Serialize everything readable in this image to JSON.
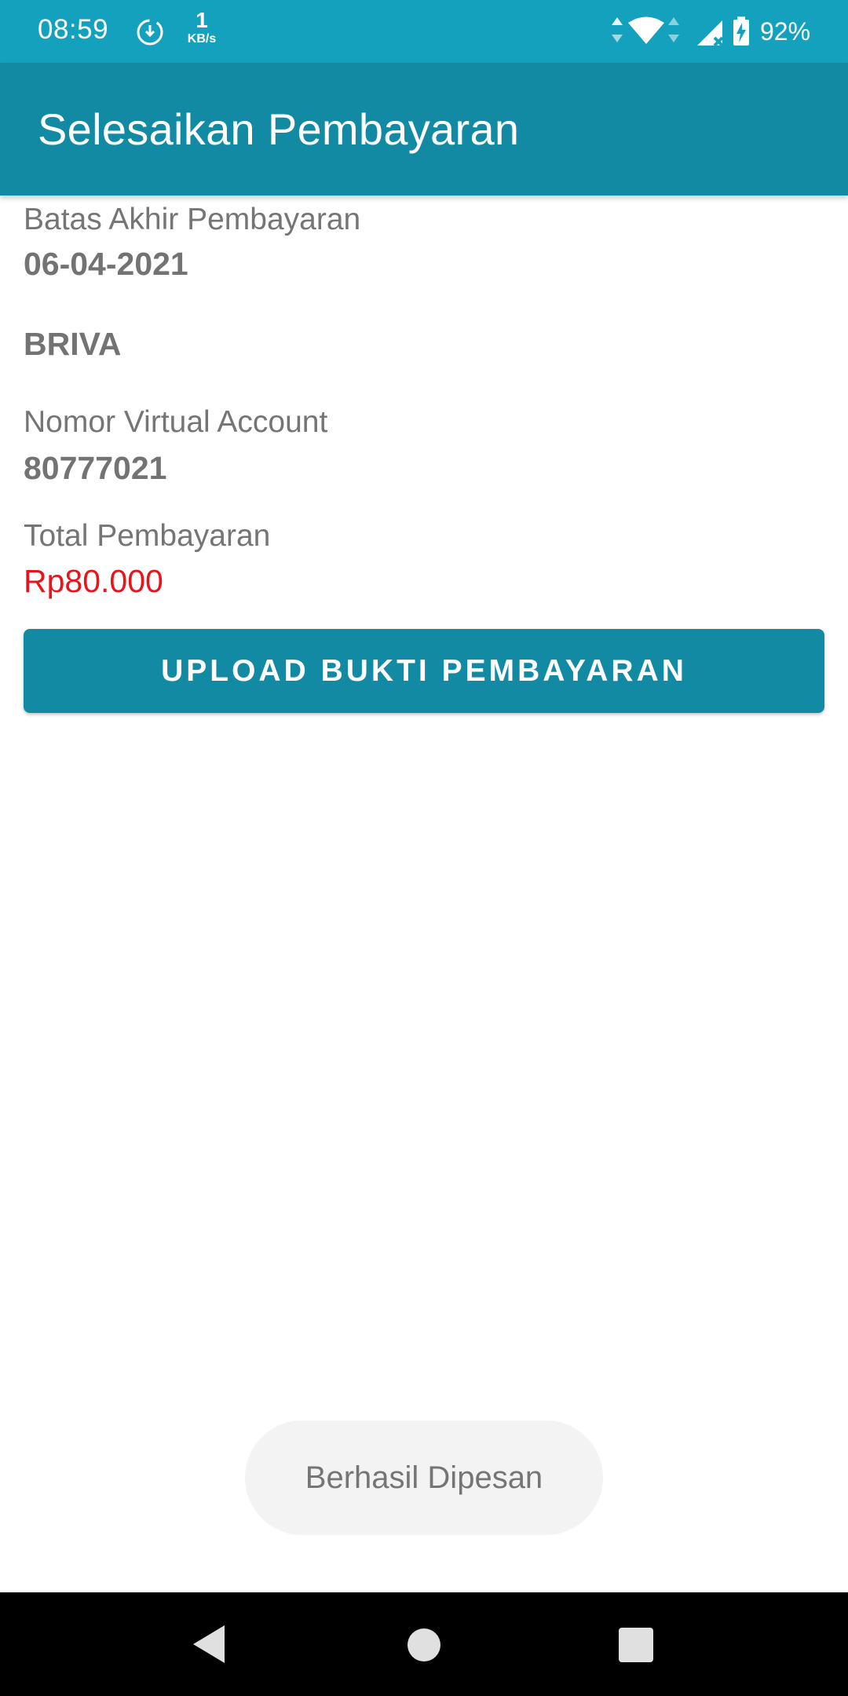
{
  "status_bar": {
    "time": "08:59",
    "speed_value": "1",
    "speed_unit": "KB/s",
    "battery": "92%",
    "icons": [
      "sync-icon",
      "data-arrows-icon",
      "wifi-icon",
      "signal-icon",
      "battery-icon"
    ]
  },
  "app_bar": {
    "title": "Selesaikan Pembayaran"
  },
  "payment": {
    "deadline_label": "Batas Akhir Pembayaran",
    "deadline_value": "06-04-2021",
    "bank": "BRIVA",
    "va_label": "Nomor Virtual Account",
    "va_value": "80777021",
    "total_label": "Total Pembayaran",
    "total_value": "Rp80.000"
  },
  "actions": {
    "upload_label": "UPLOAD BUKTI PEMBAYARAN"
  },
  "toast": {
    "message": "Berhasil Dipesan"
  },
  "nav_bar": {
    "icons": [
      "back-icon",
      "home-icon",
      "recents-icon"
    ]
  },
  "colors": {
    "status_bar": "#14a1bd",
    "primary": "#138aa3",
    "total_price": "#e8141c",
    "text_secondary": "#757575"
  }
}
